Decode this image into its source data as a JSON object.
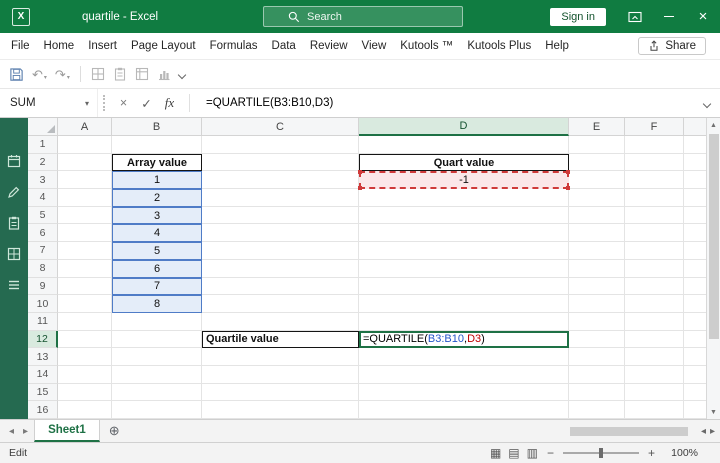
{
  "colors": {
    "excel_green": "#107C41",
    "accent_green": "#1E7145",
    "ref_blue": "#2456C9",
    "ref_red": "#C00000",
    "array_fill": "#E4EDF9",
    "array_border": "#4F7CC7",
    "quart_fill": "#FBE7E9",
    "quart_border": "#CF3A3A"
  },
  "titlebar": {
    "title": "quartile - Excel",
    "search_placeholder": "Search",
    "sign_in_label": "Sign in"
  },
  "menubar": {
    "items": [
      "File",
      "Home",
      "Insert",
      "Page Layout",
      "Formulas",
      "Data",
      "Review",
      "View",
      "Kutools ™",
      "Kutools Plus",
      "Help"
    ],
    "share_label": "Share"
  },
  "formula_bar": {
    "name_box_value": "SUM",
    "fx_label": "fx",
    "formula": "=QUARTILE(B3:B10,D3)"
  },
  "sheet": {
    "col_headers": [
      "A",
      "B",
      "C",
      "D",
      "E",
      "F"
    ],
    "selected_col": "D",
    "selected_row": "12",
    "row_count": 16,
    "cells": {
      "B2": {
        "type": "box",
        "text": "Array value"
      },
      "B3": {
        "type": "array",
        "text": "1"
      },
      "B4": {
        "type": "array",
        "text": "2"
      },
      "B5": {
        "type": "array",
        "text": "3"
      },
      "B6": {
        "type": "array",
        "text": "4"
      },
      "B7": {
        "type": "array",
        "text": "5"
      },
      "B8": {
        "type": "array",
        "text": "6"
      },
      "B9": {
        "type": "array",
        "text": "7"
      },
      "B10": {
        "type": "array",
        "text": "8"
      },
      "D2": {
        "type": "box",
        "text": "Quart value"
      },
      "D3": {
        "type": "quart",
        "text": "-1"
      },
      "C12": {
        "type": "box-left",
        "text": "Quartile value"
      },
      "D12": {
        "type": "formula",
        "parts": [
          {
            "text": "=QUARTILE(",
            "color": "#000000"
          },
          {
            "text": "B3:B10",
            "color": "#2456C9"
          },
          {
            "text": ",",
            "color": "#000000"
          },
          {
            "text": "D3",
            "color": "#C00000"
          },
          {
            "text": ")",
            "color": "#000000"
          }
        ]
      }
    }
  },
  "tabs": {
    "sheet_name": "Sheet1"
  },
  "status": {
    "mode": "Edit",
    "zoom_label": "100%"
  },
  "icons": {
    "logo": "X",
    "close": "×",
    "dropdown": "▾",
    "cancel": "×",
    "enter": "✓",
    "undo": "↶",
    "redo": "↷",
    "tab_prev": "◂",
    "tab_next": "▸",
    "scroll_up": "▲",
    "scroll_down": "▼",
    "scroll_left": "◂",
    "scroll_right": "▸",
    "new_sheet": "⊕",
    "view_normal": "▦",
    "view_layout": "▤",
    "view_break": "▥",
    "zoom_out": "−",
    "zoom_in": "+"
  }
}
